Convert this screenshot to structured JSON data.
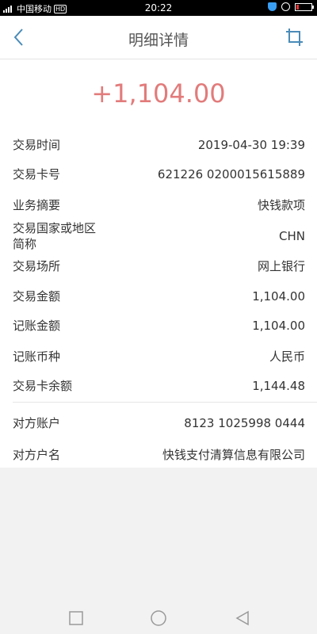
{
  "status_bar": {
    "carrier": "中国移动",
    "hd": "HD",
    "time": "20:22",
    "battery_color": "#e33333"
  },
  "header": {
    "title": "明细详情",
    "back_icon": "chevron-left-icon",
    "action_icon": "crop-icon"
  },
  "transaction": {
    "amount": "+1,104.00",
    "amount_color": "#e27b7b",
    "details": [
      {
        "label": "交易时间",
        "value": "2019-04-30 19:39"
      },
      {
        "label": "交易卡号",
        "value": "621226 0200015615889"
      },
      {
        "label": "业务摘要",
        "value": "快钱款项"
      },
      {
        "label": "交易国家或地区\n简称",
        "value": "CHN"
      },
      {
        "label": "交易场所",
        "value": "网上银行"
      },
      {
        "label": "交易金额",
        "value": "1,104.00"
      },
      {
        "label": "记账金额",
        "value": "1,104.00"
      },
      {
        "label": "记账币种",
        "value": "人民币"
      },
      {
        "label": "交易卡余额",
        "value": "1,144.48"
      }
    ],
    "counterparty": [
      {
        "label": "对方账户",
        "value": "8123 1025998 0444"
      },
      {
        "label": "对方户名",
        "value": "快钱支付清算信息有限公司"
      }
    ]
  },
  "nav_bar": {
    "recent": "square-icon",
    "home": "circle-icon",
    "back": "triangle-back-icon"
  }
}
